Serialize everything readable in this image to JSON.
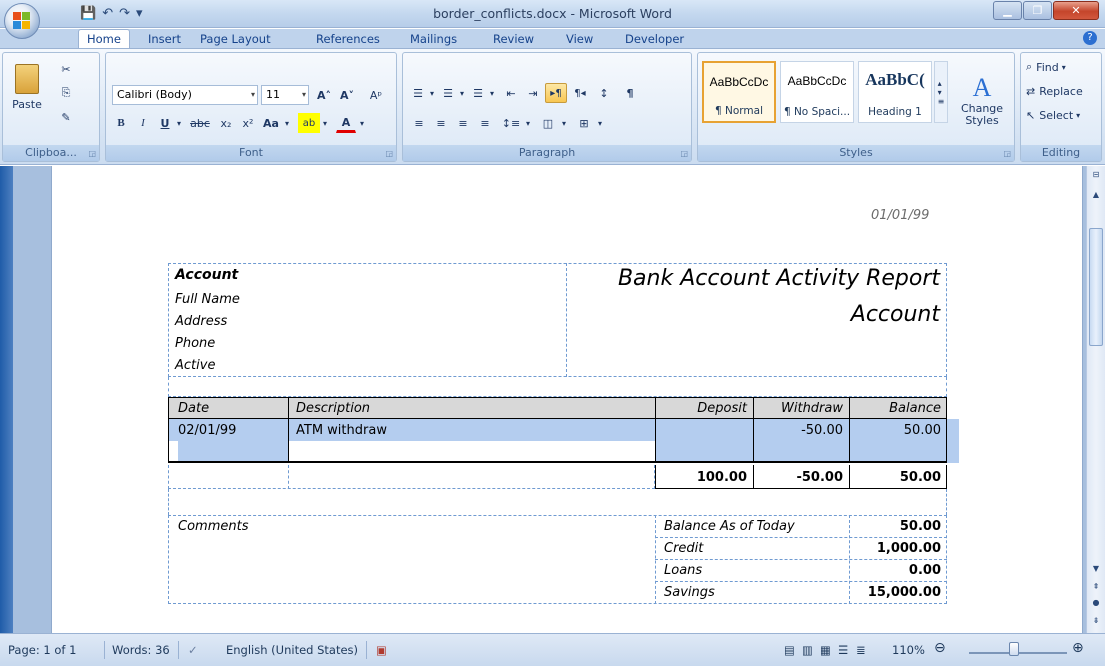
{
  "window": {
    "title": "border_conflicts.docx - Microsoft Word"
  },
  "qat": [
    "💾",
    "↶",
    "↷",
    "▾"
  ],
  "tabs": [
    "Home",
    "Insert",
    "Page Layout",
    "References",
    "Mailings",
    "Review",
    "View",
    "Developer"
  ],
  "ribbon": {
    "clipboard": {
      "label": "Clipboa...",
      "paste": "Paste"
    },
    "font": {
      "label": "Font",
      "family": "Calibri (Body)",
      "size": "11",
      "row1": [
        "A˄",
        "A˅",
        "Aᵖ"
      ],
      "row2": [
        "B",
        "I",
        "U",
        "▾",
        "abc",
        "x₂",
        "x²",
        "Aa",
        "▾",
        "ab",
        "▾",
        "A",
        "▾"
      ]
    },
    "paragraph": {
      "label": "Paragraph",
      "row1": [
        "☰",
        "▾",
        "☰",
        "▾",
        "☰",
        "▾",
        "⇤",
        "⇥",
        "▸¶",
        "¶◂",
        "↕",
        "¶"
      ],
      "row2": [
        "≡",
        "≡",
        "≡",
        "≡",
        "↕≡",
        "▾",
        "◫",
        "▾",
        "⊞",
        "▾"
      ]
    },
    "styles": {
      "label": "Styles",
      "items": [
        {
          "preview": "AaBbCcDc",
          "name": "¶ Normal"
        },
        {
          "preview": "AaBbCcDc",
          "name": "¶ No Spaci..."
        },
        {
          "preview": "AaBbC(",
          "name": "Heading 1"
        }
      ],
      "change": "Change Styles"
    },
    "editing": {
      "label": "Editing",
      "find": "Find",
      "replace": "Replace",
      "select": "Select"
    }
  },
  "document": {
    "date": "01/01/99",
    "account": {
      "heading": "Account",
      "fields": [
        "Full Name",
        "Address",
        "Phone",
        "Active"
      ]
    },
    "report_title": "Bank Account Activity Report",
    "report_subtitle": "Account",
    "table": {
      "headers": [
        "Date",
        "Description",
        "Deposit",
        "Withdraw",
        "Balance"
      ],
      "rows": [
        [
          "02/01/99",
          "ATM withdraw",
          "",
          "-50.00",
          "50.00"
        ],
        [
          "",
          "",
          "",
          "",
          ""
        ]
      ],
      "totals": [
        "",
        "",
        "100.00",
        "-50.00",
        "50.00"
      ]
    },
    "comments_label": "Comments",
    "summary": [
      [
        "Balance As of Today",
        "50.00"
      ],
      [
        "Credit",
        "1,000.00"
      ],
      [
        "Loans",
        "0.00"
      ],
      [
        "Savings",
        "15,000.00"
      ]
    ]
  },
  "status": {
    "page": "Page: 1 of 1",
    "words": "Words: 36",
    "language": "English (United States)",
    "zoom": "110%"
  },
  "colors": {
    "selection": "#b4cdef",
    "header_fill": "#d8d8d8",
    "border": "#6f9ad1"
  }
}
